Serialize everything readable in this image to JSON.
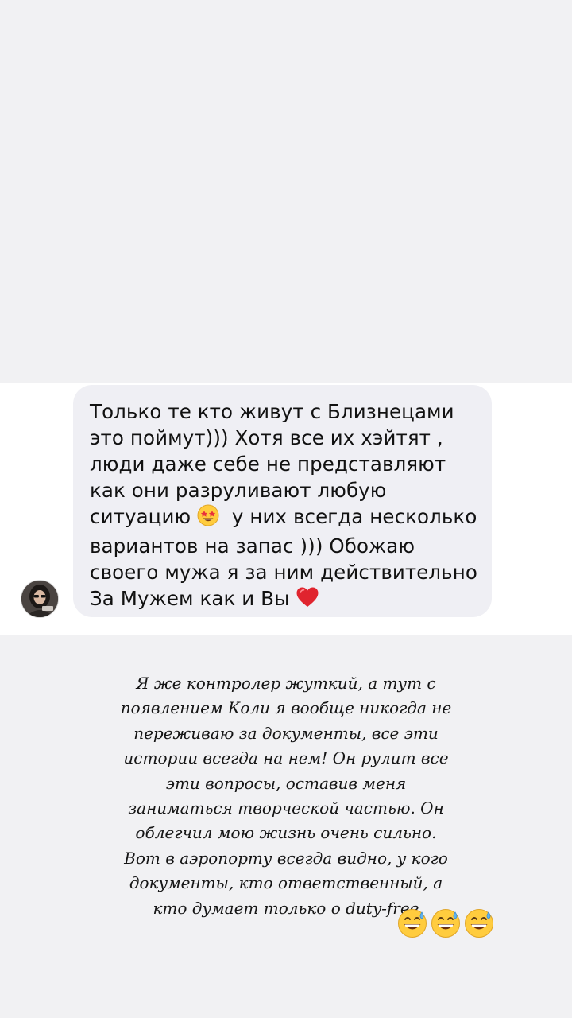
{
  "dm_message": {
    "lines": [
      "Только те кто живут с Близнецами",
      "это поймут))) Хотя все их хэйтят ,",
      "люди  даже себе не представляют",
      "как они разруливают любую",
      "ситуацию",
      "у них всегда несколько",
      "вариантов на запас ))) Обожаю",
      "своего мужа я за ним действительно",
      "За Мужем как и Вы"
    ],
    "inline_emoji": [
      "star-struck-icon",
      "red-heart-icon"
    ]
  },
  "story_caption": {
    "lines": [
      "Я же контролер жуткий, а тут с",
      "появлением Коли я вообще никогда не",
      "переживаю за документы, все эти",
      "истории всегда на нем! Он рулит все",
      "эти вопросы, оставив меня",
      "заниматься творческой частью. Он",
      "облегчил мою жизнь очень сильно.",
      "Вот в аэропорту всегда видно, у кого",
      "документы, кто ответственный, а",
      "кто думает только о duty-free"
    ],
    "trailing_emoji": [
      "grinning-sweat-icon",
      "grinning-sweat-icon",
      "grinning-sweat-icon"
    ]
  },
  "colors": {
    "story_background": "#f1f1f3",
    "dm_background": "#ffffff",
    "bubble_background": "#efeff4",
    "text": "#111111"
  }
}
